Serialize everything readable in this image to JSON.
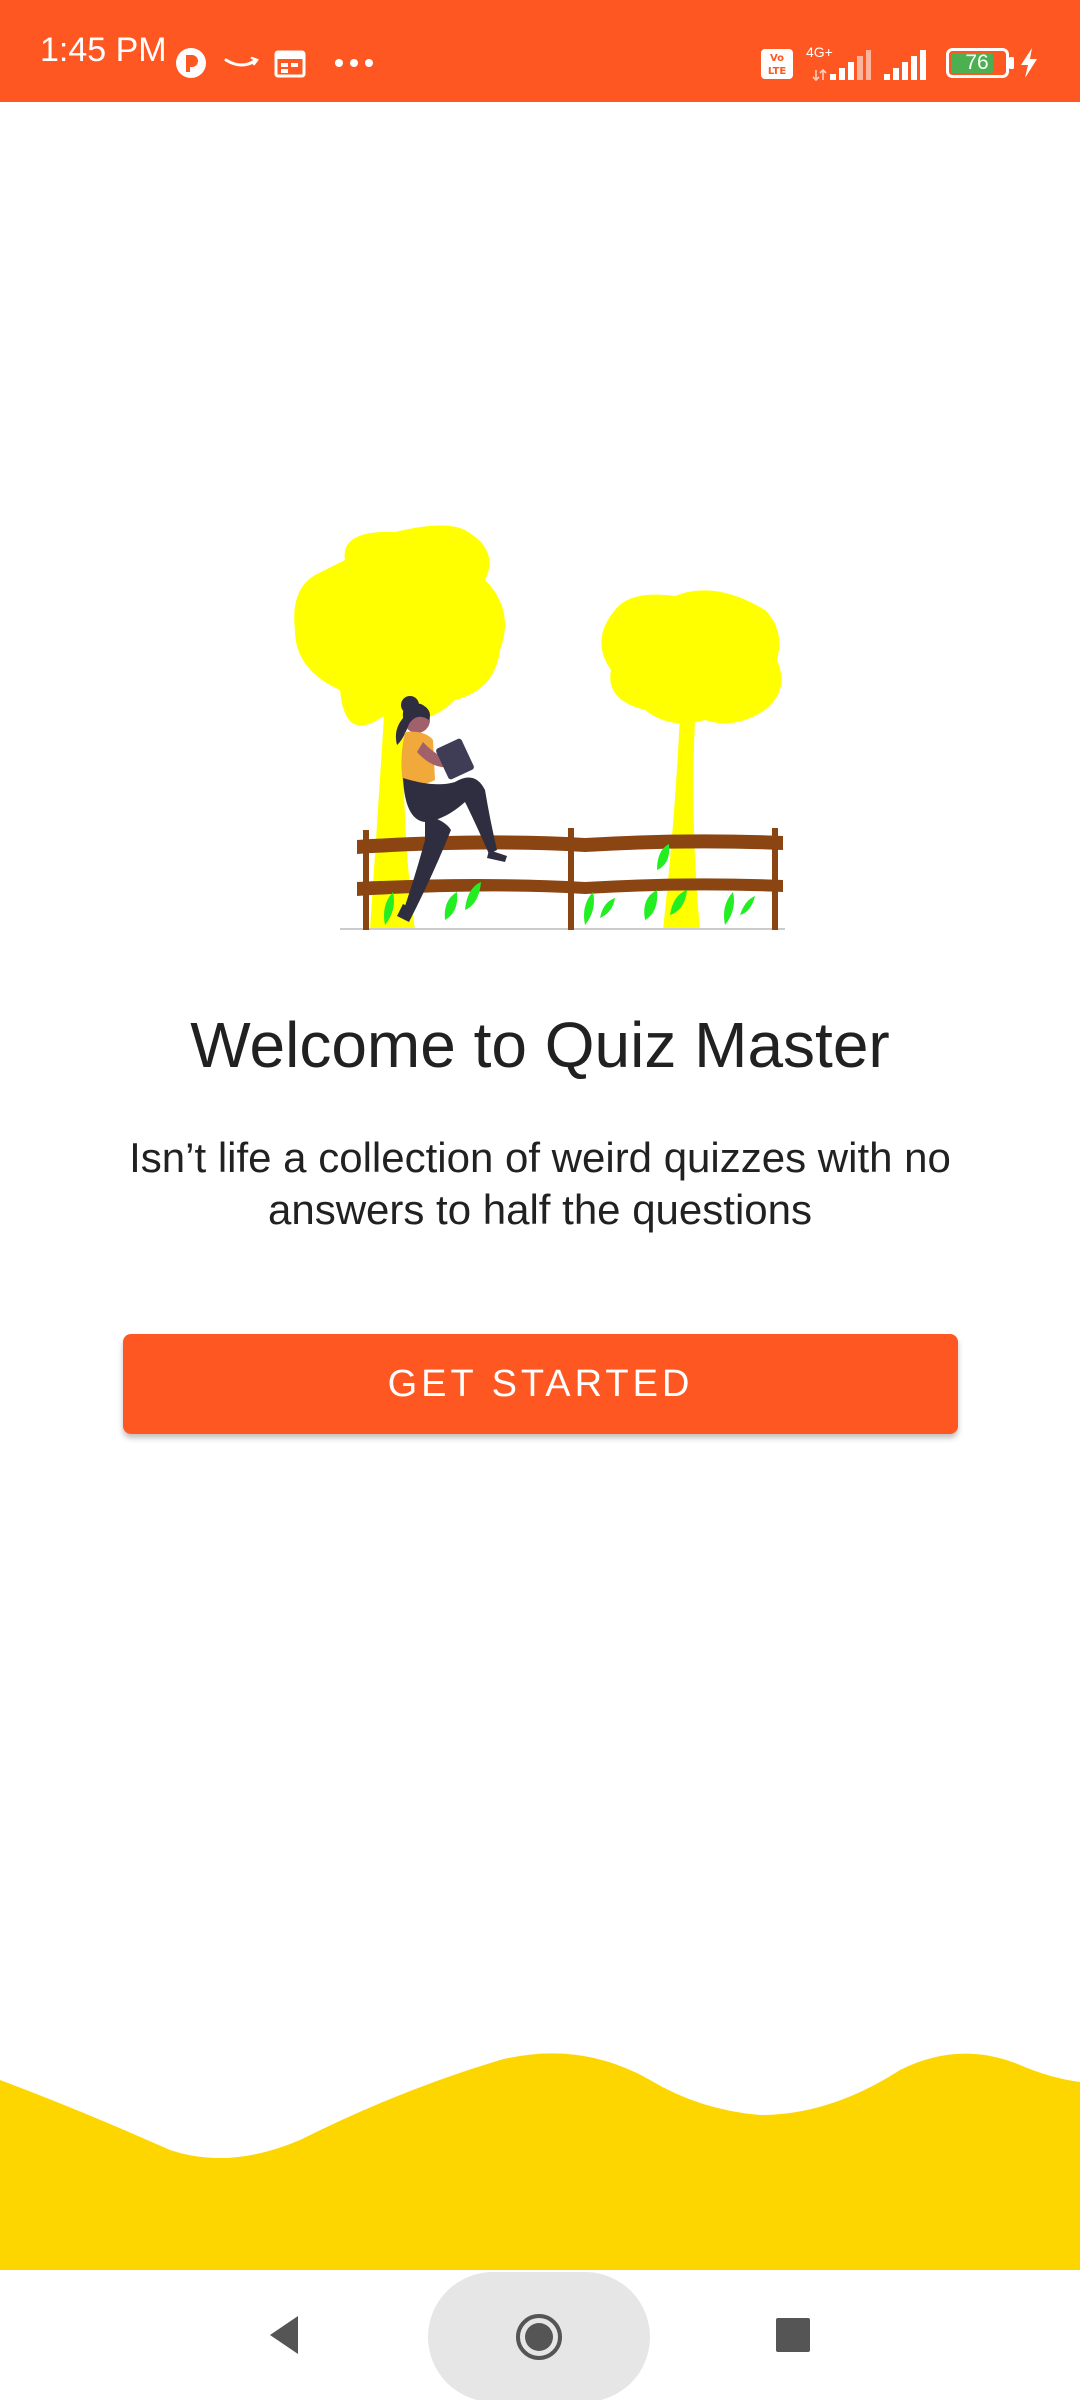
{
  "status_bar": {
    "time": "1:45 PM",
    "network_label": "4G+",
    "volte_label": "Vo LTE",
    "battery_level": "76",
    "icons": [
      "app-notification-icon",
      "amazon-icon",
      "calendar-icon",
      "more-dots-icon",
      "volte-icon",
      "signal-icon",
      "signal-icon-2",
      "battery-icon",
      "charging-icon"
    ],
    "colors": {
      "background": "#FF5722"
    }
  },
  "main": {
    "title": "Welcome to Quiz Master",
    "subtitle": "Isn’t life a collection of weird quizzes with no answers to half the questions",
    "get_started_label": "GET STARTED",
    "illustration_icon": "woman-on-fence-illustration",
    "colors": {
      "accent": "#FF5722",
      "wave": "#FDD600",
      "tree": "#FFFF00"
    }
  },
  "nav_bar": {
    "icons": [
      "back-icon",
      "home-icon",
      "recents-icon"
    ]
  }
}
